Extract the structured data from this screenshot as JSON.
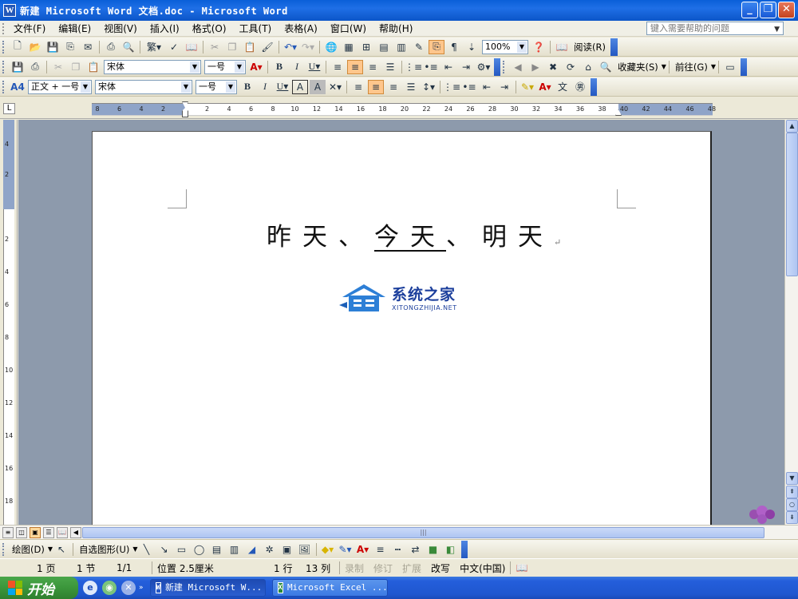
{
  "window": {
    "title": "新建 Microsoft Word 文档.doc - Microsoft Word",
    "app_icon": "W",
    "controls": [
      "_",
      "❐",
      "✕"
    ]
  },
  "menu": {
    "items": [
      "文件(F)",
      "编辑(E)",
      "视图(V)",
      "插入(I)",
      "格式(O)",
      "工具(T)",
      "表格(A)",
      "窗口(W)",
      "帮助(H)"
    ],
    "help_placeholder": "键入需要帮助的问题"
  },
  "standard_toolbar": {
    "zoom": "100%",
    "read_label": "阅读(R)"
  },
  "formatting_toolbar": {
    "font": "宋体",
    "size": "一号",
    "favorites_label": "收藏夹(S)",
    "goto_label": "前往(G)"
  },
  "formatting_toolbar2": {
    "style": "正文 + 一号",
    "font": "宋体",
    "size": "一号"
  },
  "ruler": {
    "corner": "L",
    "h_labels": [
      "8",
      "6",
      "4",
      "2",
      "2",
      "4",
      "6",
      "8",
      "10",
      "12",
      "14",
      "16",
      "18",
      "20",
      "22",
      "24",
      "26",
      "28",
      "30",
      "32",
      "34",
      "36",
      "38",
      "40",
      "42",
      "44",
      "46",
      "48"
    ],
    "v_labels": [
      "4",
      "2",
      "2",
      "4",
      "6",
      "8",
      "10",
      "12",
      "14",
      "16",
      "18"
    ]
  },
  "document": {
    "text_before": "昨天、",
    "text_underlined": "今天",
    "text_after": "、明天",
    "paragraph_mark": "↵"
  },
  "watermark": {
    "cn": "系统之家",
    "en": "XITONGZHIJIA.NET"
  },
  "drawing_toolbar": {
    "draw_label": "绘图(D)",
    "autoshape_label": "自选图形(U)"
  },
  "status": {
    "page": "1 页",
    "section": "1 节",
    "page_of": "1/1",
    "position": "位置 2.5厘米",
    "line": "1 行",
    "column": "13 列",
    "rec": "录制",
    "trk": "修订",
    "ext": "扩展",
    "ovr": "改写",
    "language": "中文(中国)"
  },
  "taskbar": {
    "start_label": "开始",
    "items": [
      {
        "label": "新建 Microsoft W...",
        "icon": "W",
        "active": true
      },
      {
        "label": "Microsoft Excel ...",
        "icon": "X",
        "active": false
      }
    ]
  },
  "colors": {
    "titlebar": "#0b55c8",
    "page_bg": "#ffffff",
    "workspace": "#8d9aac",
    "highlight_button": "#ffc68c"
  }
}
